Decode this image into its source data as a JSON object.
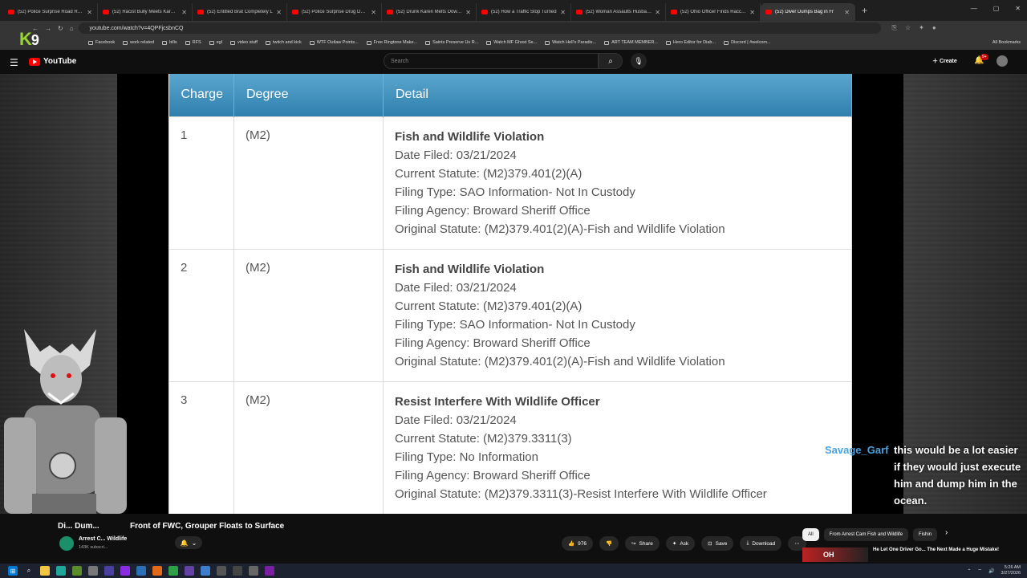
{
  "browser": {
    "tabs": [
      {
        "title": "(52) Police Surprise Road Rage"
      },
      {
        "title": "(52) Racist Bully Meets Karma a"
      },
      {
        "title": "(52) Entitled Brat Completely L"
      },
      {
        "title": "(52) Police Surprise Drug Deale"
      },
      {
        "title": "(52) Drunk Karen Melts Down a"
      },
      {
        "title": "(52) How a Traffic Stop Turned"
      },
      {
        "title": "(52) Woman Assaults Husband"
      },
      {
        "title": "(52) Ohio Officer Finds Raccoo"
      },
      {
        "title": "(52) Diver Dumps Bag in Fr"
      }
    ],
    "active_tab": 8,
    "new_tab": "+",
    "url": "youtube.com/watch?v=4QPFjcsbnCQ",
    "bookmarks": [
      "Facebook",
      "work related",
      "bills",
      "RFS",
      "egl",
      "video stuff",
      "twitch and kick",
      "WTF Outlaw Points...",
      "Free Ringtone Make...",
      "Saints Preserve Us R...",
      "Watch MF Ghost Se...",
      "Watch Hell's Paradis...",
      "ART TEAM MEMBER...",
      "Hero Editor for Diab...",
      "Discord | #welcom..."
    ],
    "all_bookmarks": "All Bookmarks"
  },
  "overlay": {
    "k": "K",
    "nine": "9"
  },
  "youtube": {
    "logo": "YouTube",
    "search_placeholder": "Search",
    "create": "Create",
    "notif_badge": "9+"
  },
  "table": {
    "headers": [
      "Charge",
      "Degree",
      "Detail"
    ],
    "rows": [
      {
        "charge": "1",
        "degree": "(M2)",
        "title": "Fish and Wildlife Violation",
        "lines": [
          "Date Filed: 03/21/2024",
          "Current Statute: (M2)379.401(2)(A)",
          "Filing Type: SAO Information- Not In Custody",
          "Filing Agency: Broward Sheriff Office",
          "Original Statute: (M2)379.401(2)(A)-Fish and Wildlife Violation"
        ]
      },
      {
        "charge": "2",
        "degree": "(M2)",
        "title": "Fish and Wildlife Violation",
        "lines": [
          "Date Filed: 03/21/2024",
          "Current Statute: (M2)379.401(2)(A)",
          "Filing Type: SAO Information- Not In Custody",
          "Filing Agency: Broward Sheriff Office",
          "Original Statute: (M2)379.401(2)(A)-Fish and Wildlife Violation"
        ]
      },
      {
        "charge": "3",
        "degree": "(M2)",
        "title": "Resist Interfere With Wildlife Officer",
        "lines": [
          "Date Filed: 03/21/2024",
          "Current Statute: (M2)379.3311(3)",
          "Filing Type: No Information",
          "Filing Agency: Broward Sheriff Office",
          "Original Statute: (M2)379.3311(3)-Resist Interfere With Wildlife Officer"
        ]
      }
    ]
  },
  "chat": {
    "user": "Savage_Garf",
    "message": "this would be a lot easier if they would just execute him and dump him in the ocean."
  },
  "video": {
    "title_part1": "Di... Dum...",
    "title_part2": "Front of FWC, Grouper Floats to Surface",
    "channel": "Arrest C... Wildlife",
    "subs": "143K subscri...",
    "likes": "976",
    "share": "Share",
    "ask": "Ask",
    "save": "Save",
    "download": "Download",
    "more": "⋯"
  },
  "sidebar": {
    "chips": [
      "All",
      "From Arrest Cam Fish and Wildlife",
      "Fishin"
    ],
    "reco_title": "He Let One Driver Go... The Next Made a Huge Mistake!",
    "reco_thumb_text": "OH"
  },
  "taskbar": {
    "time": "5:26 AM",
    "date": "3/27/2026"
  }
}
